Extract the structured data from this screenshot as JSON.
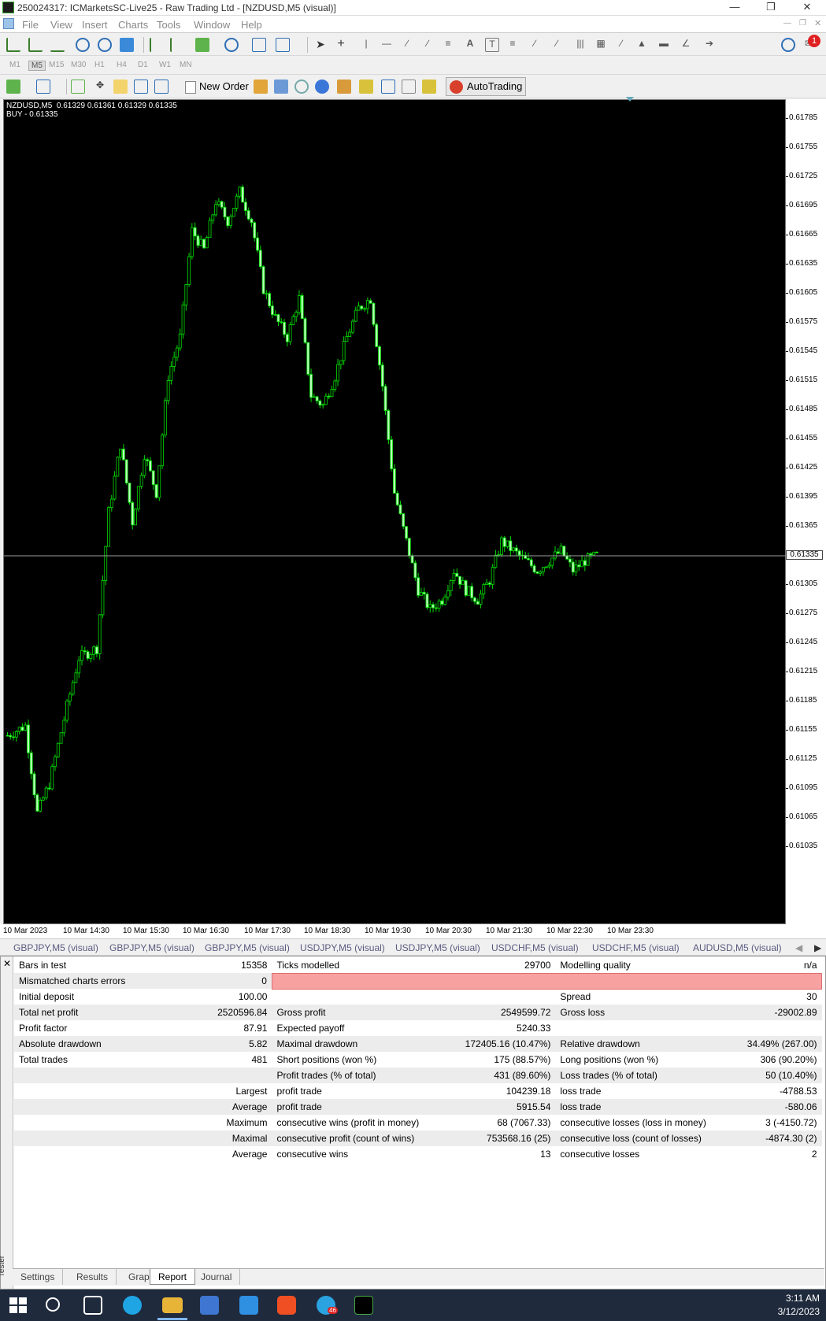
{
  "window": {
    "title": "250024317: ICMarketsSC-Live25 - Raw Trading Ltd - [NZDUSD,M5 (visual)]"
  },
  "menu": [
    "File",
    "View",
    "Insert",
    "Charts",
    "Tools",
    "Window",
    "Help"
  ],
  "timeframes": [
    "M1",
    "M5",
    "M15",
    "M30",
    "H1",
    "H4",
    "D1",
    "W1",
    "MN"
  ],
  "toolbar": {
    "new_order": "New Order",
    "auto_trading": "AutoTrading"
  },
  "chart": {
    "info_line1": "NZDUSD,M5  0.61329 0.61361 0.61329 0.61335",
    "info_line2": "BUY - 0.61335",
    "current_price": "0.61335",
    "y_labels": [
      "0.61785",
      "0.61755",
      "0.61725",
      "0.61695",
      "0.61665",
      "0.61635",
      "0.61605",
      "0.61575",
      "0.61545",
      "0.61515",
      "0.61485",
      "0.61455",
      "0.61425",
      "0.61395",
      "0.61365",
      "0.61305",
      "0.61275",
      "0.61245",
      "0.61215",
      "0.61185",
      "0.61155",
      "0.61125",
      "0.61095",
      "0.61065",
      "0.61035"
    ],
    "x_labels": [
      "10 Mar 2023",
      "10 Mar 14:30",
      "10 Mar 15:30",
      "10 Mar 16:30",
      "10 Mar 17:30",
      "10 Mar 18:30",
      "10 Mar 19:30",
      "10 Mar 20:30",
      "10 Mar 21:30",
      "10 Mar 22:30",
      "10 Mar 23:30"
    ],
    "colors": {
      "bull": "#00ff00",
      "bear": "#00cc00",
      "background": "#000000",
      "bid_line": "#9e9e9e"
    }
  },
  "chart_tabs": [
    "GBPJPY,M5 (visual)",
    "GBPJPY,M5 (visual)",
    "GBPJPY,M5 (visual)",
    "USDJPY,M5 (visual)",
    "USDJPY,M5 (visual)",
    "USDCHF,M5 (visual)",
    "USDCHF,M5 (visual)",
    "AUDUSD,M5 (visual)"
  ],
  "report": {
    "rows": [
      [
        "Bars in test",
        "15358",
        "Ticks modelled",
        "29700",
        "Modelling quality",
        "n/a"
      ],
      [
        "Mismatched charts errors",
        "0",
        "",
        "",
        "",
        ""
      ],
      [
        "Initial deposit",
        "100.00",
        "",
        "",
        "Spread",
        "30"
      ],
      [
        "Total net profit",
        "2520596.84",
        "Gross profit",
        "2549599.72",
        "Gross loss",
        "-29002.89"
      ],
      [
        "Profit factor",
        "87.91",
        "Expected payoff",
        "5240.33",
        "",
        ""
      ],
      [
        "Absolute drawdown",
        "5.82",
        "Maximal drawdown",
        "172405.16 (10.47%)",
        "Relative drawdown",
        "34.49% (267.00)"
      ],
      [
        "Total trades",
        "481",
        "Short positions (won %)",
        "175 (88.57%)",
        "Long positions (won %)",
        "306 (90.20%)"
      ],
      [
        "",
        "",
        "Profit trades (% of total)",
        "431 (89.60%)",
        "Loss trades (% of total)",
        "50 (10.40%)"
      ],
      [
        "",
        "Largest",
        "profit trade",
        "104239.18",
        "loss trade",
        "-4788.53"
      ],
      [
        "",
        "Average",
        "profit trade",
        "5915.54",
        "loss trade",
        "-580.06"
      ],
      [
        "",
        "Maximum",
        "consecutive wins (profit in money)",
        "68 (7067.33)",
        "consecutive losses (loss in money)",
        "3 (-4150.72)"
      ],
      [
        "",
        "Maximal",
        "consecutive profit (count of wins)",
        "753568.16 (25)",
        "consecutive loss (count of losses)",
        "-4874.30 (2)"
      ],
      [
        "",
        "Average",
        "consecutive wins",
        "13",
        "consecutive losses",
        "2"
      ]
    ]
  },
  "tester": {
    "side_label": "Tester",
    "tabs": [
      "Settings",
      "Results",
      "Graph",
      "Report",
      "Journal"
    ],
    "active_tab": "Report"
  },
  "taskbar": {
    "time": "3:11 AM",
    "date": "3/12/2023",
    "telegram_badge": "46",
    "notification_badge": "1"
  }
}
